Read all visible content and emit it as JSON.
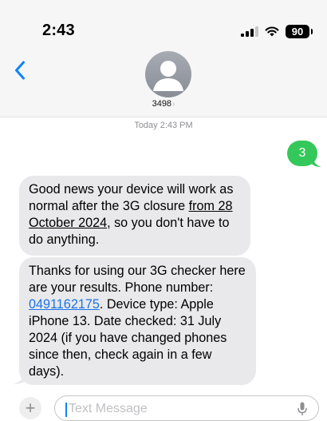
{
  "status_bar": {
    "time": "2:43",
    "battery": "90",
    "icons": [
      "signal-icon",
      "wifi-icon",
      "battery-icon"
    ]
  },
  "header": {
    "contact_name": "3498",
    "chevron": "›"
  },
  "conversation": {
    "timestamp": "Today 2:43 PM",
    "sent_message": "3",
    "bubble1": {
      "part1": "Good news your device will work as normal after the 3G closure ",
      "underlined": "from 28 October 2024",
      "part2": ", so you don't have to do anything."
    },
    "bubble2": {
      "part1": "Thanks for using our 3G checker here are your results. Phone number: ",
      "phone_link": "0491162175",
      "part2": ". Device type: Apple iPhone 13. Date checked: 31 July 2024 (if you have changed phones since then, check again in a few days)."
    }
  },
  "composer": {
    "plus": "+",
    "placeholder": "Text Message"
  },
  "colors": {
    "sent_bubble": "#34c759",
    "received_bubble": "#e9e9eb",
    "link": "#1a73e8",
    "accent": "#0a84ff"
  }
}
